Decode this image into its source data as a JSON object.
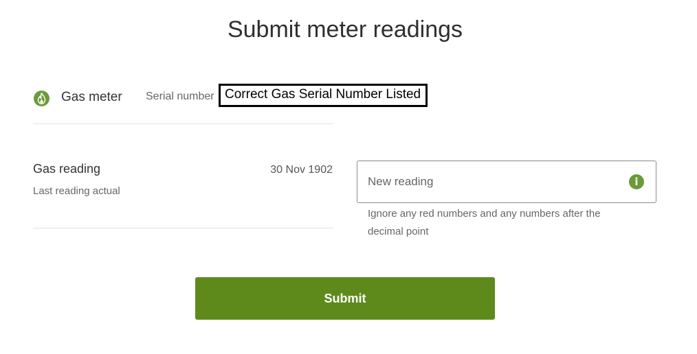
{
  "page": {
    "title": "Submit meter readings"
  },
  "meter": {
    "icon": "flame-icon",
    "label": "Gas meter",
    "serial_label": "Serial number",
    "serial_value": "Correct Gas Serial Number Listed"
  },
  "reading": {
    "title": "Gas reading",
    "subtitle": "Last reading actual",
    "date": "30 Nov 1902",
    "input": {
      "placeholder": "New reading",
      "value": ""
    },
    "info_icon": "info-icon",
    "hint": "Ignore any red numbers and any numbers after the decimal point"
  },
  "actions": {
    "submit_label": "Submit"
  },
  "colors": {
    "accent": "#5e8a1c",
    "icon": "#6a9a3a"
  }
}
